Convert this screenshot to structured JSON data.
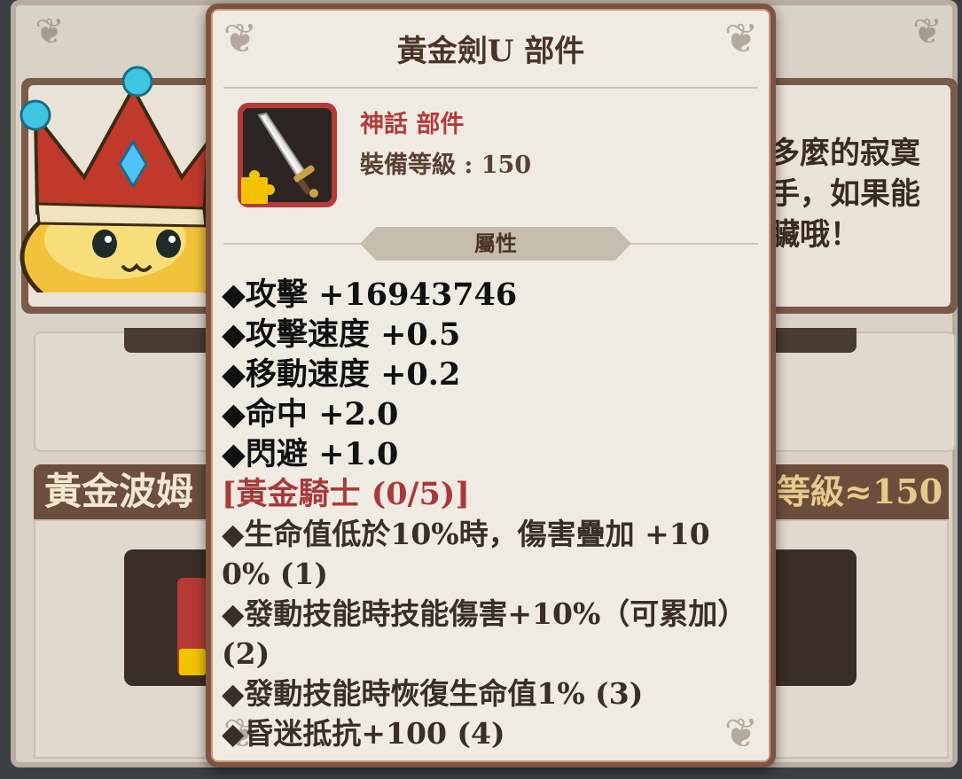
{
  "background": {
    "dialog_text_lines": [
      "多麼的寂寞",
      "手，如果能",
      "臟哦！"
    ],
    "section_title": "黃金波姆",
    "section_level": "等級≈150"
  },
  "tooltip": {
    "title": "黃金劍U 部件",
    "rarity": "神話 部件",
    "equip_level": "裝備等級 : 150",
    "section_label": "屬性",
    "stats": [
      "◆攻擊 +16943746",
      "◆攻擊速度 +0.5",
      "◆移動速度 +0.2",
      "◆命中 +2.0",
      "◆閃避 +1.0"
    ],
    "set_name": "[黃金騎士 (0/5)]",
    "set_bonuses": [
      "◆生命值低於10%時，傷害疊加 +100% (1)",
      "◆發動技能時技能傷害+10%（可累加）(2)",
      "◆發動技能時恢復生命值1% (3)",
      "◆昏迷抵抗+100 (4)"
    ]
  },
  "colors": {
    "frame": "#7f5341",
    "parchment": "#efebe2",
    "rarity_red": "#b33b3b",
    "puzzle_yellow": "#f2c400"
  },
  "icons": {
    "item": "sword-icon",
    "part": "puzzle-piece-icon"
  }
}
